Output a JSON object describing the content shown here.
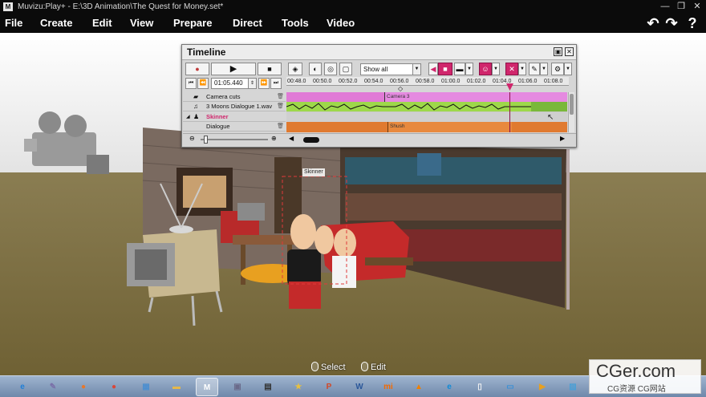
{
  "window": {
    "title": "Muvizu:Play+ - E:\\3D Animation\\The Quest for Money.set*",
    "logo": "M",
    "minimize": "—",
    "maximize": "❐",
    "close": "✕"
  },
  "menu": [
    {
      "label": "File"
    },
    {
      "label": "Create"
    },
    {
      "label": "Edit"
    },
    {
      "label": "View"
    },
    {
      "label": "Prepare"
    },
    {
      "label": "Direct"
    },
    {
      "label": "Tools"
    },
    {
      "label": "Video"
    }
  ],
  "toolbar_icons": [
    "undo-icon",
    "redo-icon",
    "help-icon"
  ],
  "timeline": {
    "title": "Timeline",
    "filter": "Show all",
    "timecode": "01:05.440",
    "ruler_ticks": [
      "00:48.0",
      "00:50.0",
      "00:52.0",
      "00:54.0",
      "00:56.0",
      "00:58.0",
      "01:00.0",
      "01:02.0",
      "01:04.0",
      "01:06.0",
      "01:08.0"
    ],
    "tracks": [
      {
        "name": "Camera cuts",
        "icon": "camera-cuts-icon"
      },
      {
        "name": "3 Moons Dialogue 1.wav",
        "icon": "audio-icon"
      },
      {
        "name": "Skinner",
        "icon": "character-icon"
      },
      {
        "name": "Dialogue",
        "icon": ""
      }
    ],
    "clip_camera": "Camera 3",
    "clip_dialogue": "Shush",
    "playhead_fraction": 0.795,
    "zoom_fraction": 0.05
  },
  "scene": {
    "character_tag": "Skinner",
    "hint_select": "Select",
    "hint_edit": "Edit"
  },
  "taskbar": {
    "icons": [
      {
        "name": "internet-explorer-icon",
        "glyph": "e",
        "color": "#1e7fd8"
      },
      {
        "name": "tools-icon",
        "glyph": "✎",
        "color": "#7a6fa8"
      },
      {
        "name": "firefox-icon",
        "glyph": "●",
        "color": "#e8772a"
      },
      {
        "name": "chrome-icon",
        "glyph": "●",
        "color": "#d8473a"
      },
      {
        "name": "network-icon",
        "glyph": "▦",
        "color": "#4d8fcf"
      },
      {
        "name": "folder-icon",
        "glyph": "▬",
        "color": "#e5b74a"
      },
      {
        "name": "muvizu-icon",
        "glyph": "M",
        "color": "#ffffff"
      },
      {
        "name": "save-icon",
        "glyph": "▣",
        "color": "#6a6a8a"
      },
      {
        "name": "film-icon",
        "glyph": "▤",
        "color": "#333333"
      },
      {
        "name": "star-icon",
        "glyph": "★",
        "color": "#e8c040"
      },
      {
        "name": "powerpoint-icon",
        "glyph": "P",
        "color": "#d24726"
      },
      {
        "name": "word-icon",
        "glyph": "W",
        "color": "#2b579a"
      },
      {
        "name": "xiaomi-icon",
        "glyph": "mi",
        "color": "#f56a00"
      },
      {
        "name": "vlc-icon",
        "glyph": "▲",
        "color": "#f08000"
      },
      {
        "name": "edge-icon",
        "glyph": "e",
        "color": "#0f8ad6"
      },
      {
        "name": "document-icon",
        "glyph": "▯",
        "color": "#f4f4f4"
      },
      {
        "name": "screen-icon",
        "glyph": "▭",
        "color": "#3a8fd6"
      },
      {
        "name": "media-player-icon",
        "glyph": "▶",
        "color": "#e8a020"
      },
      {
        "name": "image-icon",
        "glyph": "▨",
        "color": "#4a9fd6"
      }
    ]
  },
  "watermark": {
    "main": "CGer.com",
    "sub": "CG资源 CG网站"
  },
  "colors": {
    "accent": "#d0266c",
    "clip_camera": "#e07ad6",
    "clip_audio": "#9ed84a",
    "clip_dialogue": "#e07a30"
  }
}
